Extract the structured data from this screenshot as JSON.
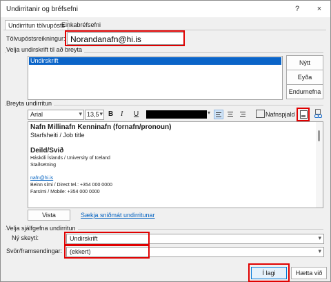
{
  "window": {
    "title": "Undirritanir og bréfsefni",
    "help": "?",
    "close": "×"
  },
  "tabs": [
    "Undirritun tölvupósts",
    "Einkabréfsefni"
  ],
  "account": {
    "label": "Tölvupóstsreikningur:",
    "value": "Norandanafn@hi.is"
  },
  "select_group": {
    "title": "Velja undirskrift til að breyta",
    "items": [
      "Undirskrift"
    ],
    "buttons": {
      "new": "Nýtt",
      "delete": "Eyða",
      "rename": "Endurnefna"
    }
  },
  "edit_group": {
    "title": "Breyta undirritun"
  },
  "toolbar": {
    "font": "Arial",
    "size": "13,5",
    "bold": "B",
    "italic": "I",
    "underline": "U",
    "business_card": "Nafnspjald"
  },
  "signature_text": {
    "line1": "Nafn Millinafn Kenninafn (fornafn/pronoun)",
    "line2": "Starfsheiti / Job title",
    "line3": "Deild/Svið",
    "line4": "Háskóli Íslands / University of Iceland",
    "line5": "Staðsetning",
    "line6": "nafn@hi.is",
    "line7": "Beinn sími / Direct tel.: +354 000 0000",
    "line8": "Farsími / Mobile: +354 000 0000"
  },
  "save_button": "Vista",
  "templates_link": "Sækja sniðmát undirritunar",
  "defaults_group": {
    "title": "Velja sjálfgefna undirritun",
    "new_label": "Ný skeyti:",
    "new_value": "Undirskrift",
    "reply_label": "Svör/framsendingar:",
    "reply_value": "(ekkert)"
  },
  "footer": {
    "ok": "Í lagi",
    "cancel": "Hætta við"
  },
  "colors": {
    "highlight": "#e00000",
    "selection": "#0a64c8",
    "link": "#0563c1"
  }
}
